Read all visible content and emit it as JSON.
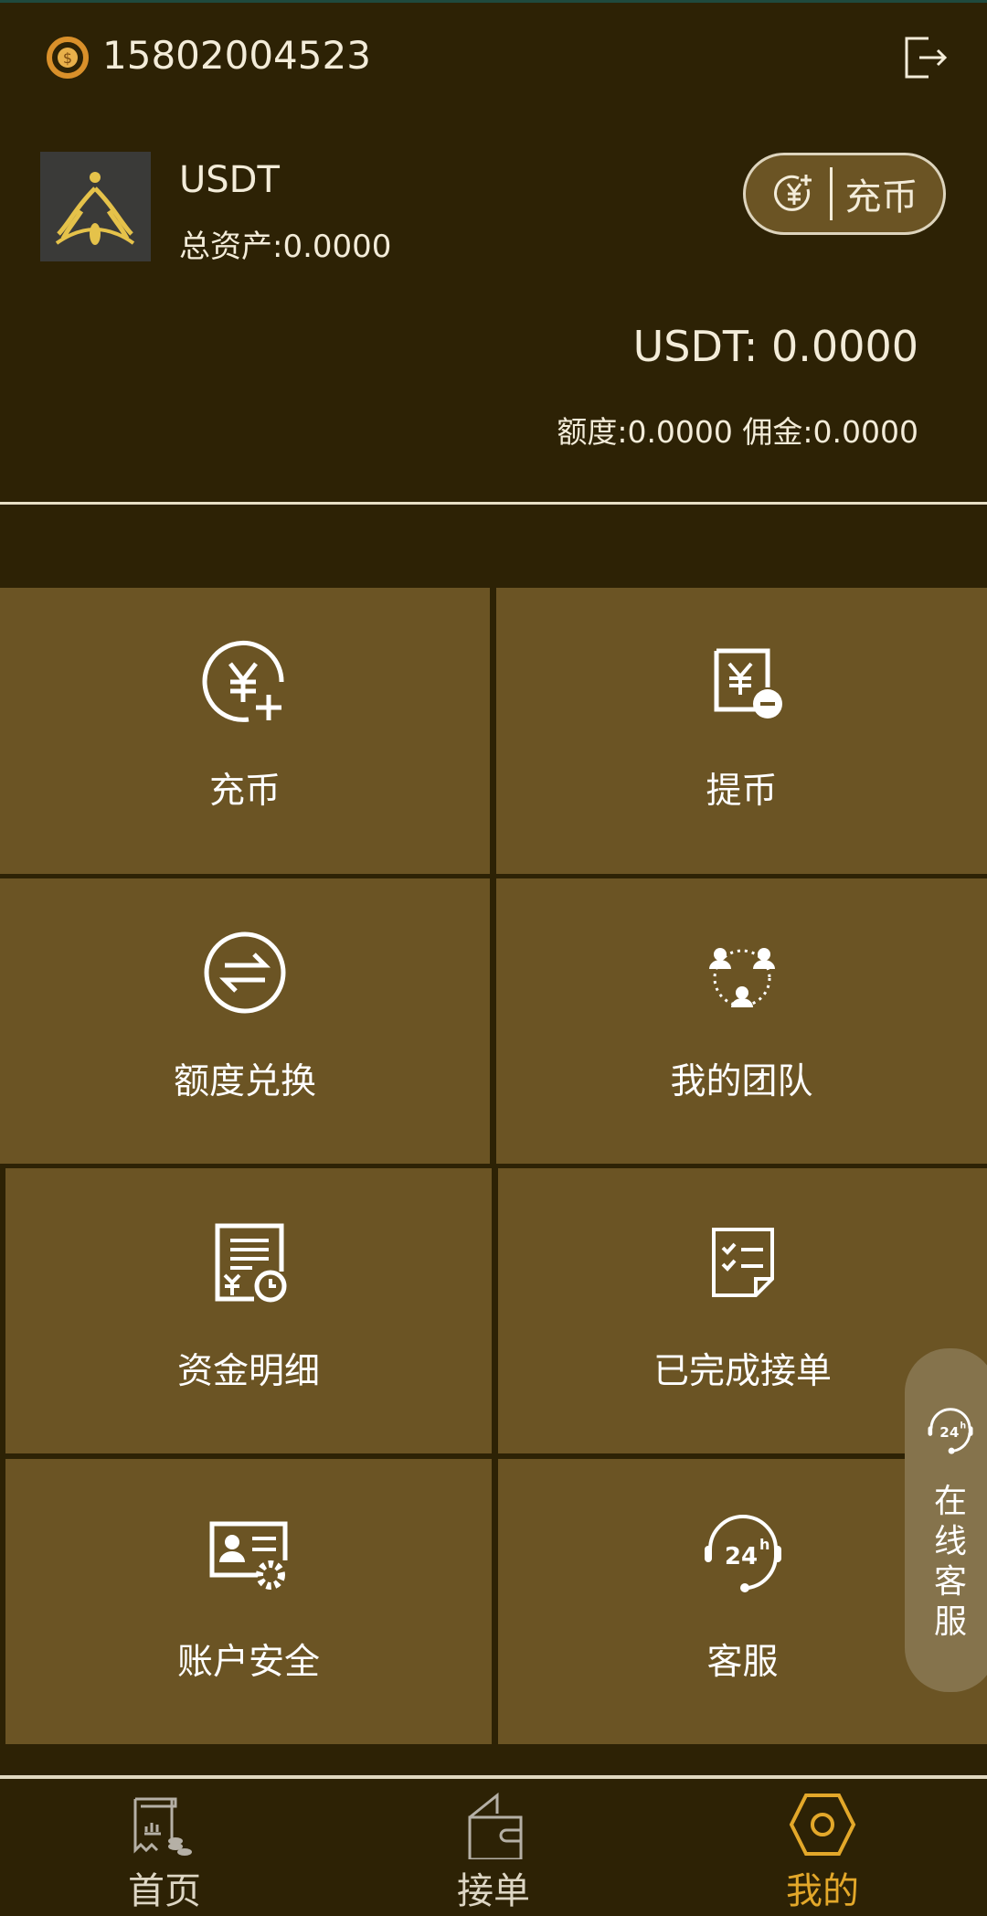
{
  "header": {
    "phone": "15802004523"
  },
  "account": {
    "coin_name": "USDT",
    "total_assets": "总资产:0.0000",
    "recharge_button": "充币"
  },
  "balance": {
    "usdt": "USDT: 0.0000",
    "quota_commission": "额度:0.0000 佣金:0.0000"
  },
  "menu": [
    {
      "label": "充币",
      "icon": "yen-plus-icon"
    },
    {
      "label": "提币",
      "icon": "yen-minus-icon"
    },
    {
      "label": "额度兑换",
      "icon": "exchange-icon"
    },
    {
      "label": "我的团队",
      "icon": "team-icon"
    },
    {
      "label": "资金明细",
      "icon": "fund-detail-icon"
    },
    {
      "label": "已完成接单",
      "icon": "checklist-icon"
    },
    {
      "label": "账户安全",
      "icon": "account-security-icon"
    },
    {
      "label": "客服",
      "icon": "support-24h-icon"
    }
  ],
  "floating": {
    "label": "在线客服"
  },
  "nav": [
    {
      "label": "首页"
    },
    {
      "label": "接单"
    },
    {
      "label": "我的"
    }
  ],
  "colors": {
    "background": "#2d2205",
    "tile": "#6b5424",
    "active": "#e3a82a"
  }
}
